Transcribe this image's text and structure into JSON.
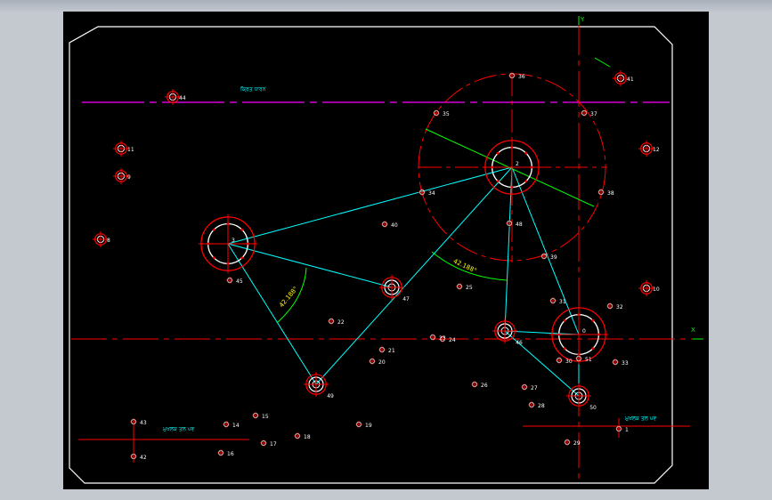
{
  "colors": {
    "background": "#000000",
    "frame": "#ffffff",
    "centerline": "#ff0000",
    "magenta_line": "#ff00ff",
    "construction": "#00ffff",
    "point_label": "#ffffff",
    "note_text": "#00ffff",
    "dimension": "#ffff00",
    "axis": "#00ff00",
    "window_chrome": "#c4c9d0"
  },
  "annotations": {
    "magenta_line_note": "ਕ੍ਰਿਤ ਧਾਰਨ",
    "bottom_left_note": "ਮੁਖਲਕ ਤਲ ਪਵ",
    "bottom_right_note": "ਮੁਖਲਕ ਤਲ ਪਵ",
    "dim_angle_left": "42.188°",
    "dim_angle_right": "42.188°",
    "axis_x": "X",
    "axis_y": "Y"
  },
  "holes": [
    {
      "label": "2",
      "type": "big"
    },
    {
      "label": "3",
      "type": "big"
    },
    {
      "label": "0",
      "type": "big"
    },
    {
      "label": "47",
      "type": "medium"
    },
    {
      "label": "49",
      "type": "medium"
    },
    {
      "label": "46",
      "type": "medium"
    },
    {
      "label": "50",
      "type": "medium"
    },
    {
      "label": "44",
      "type": "small"
    },
    {
      "label": "41",
      "type": "small"
    },
    {
      "label": "11",
      "type": "small"
    },
    {
      "label": "9",
      "type": "small"
    },
    {
      "label": "8",
      "type": "small"
    },
    {
      "label": "12",
      "type": "small"
    },
    {
      "label": "10",
      "type": "small"
    },
    {
      "label": "36",
      "type": "tiny"
    },
    {
      "label": "35",
      "type": "tiny"
    },
    {
      "label": "37",
      "type": "tiny"
    },
    {
      "label": "34",
      "type": "tiny"
    },
    {
      "label": "38",
      "type": "tiny"
    },
    {
      "label": "40",
      "type": "tiny"
    },
    {
      "label": "48",
      "type": "tiny"
    },
    {
      "label": "39",
      "type": "tiny"
    },
    {
      "label": "45",
      "type": "tiny"
    },
    {
      "label": "25",
      "type": "tiny"
    },
    {
      "label": "22",
      "type": "tiny"
    },
    {
      "label": "31",
      "type": "tiny"
    },
    {
      "label": "32",
      "type": "tiny"
    },
    {
      "label": "21",
      "type": "tiny"
    },
    {
      "label": "20",
      "type": "tiny"
    },
    {
      "label": "23",
      "type": "tiny"
    },
    {
      "label": "24",
      "type": "tiny"
    },
    {
      "label": "30",
      "type": "tiny"
    },
    {
      "label": "51",
      "type": "tiny"
    },
    {
      "label": "33",
      "type": "tiny"
    },
    {
      "label": "26",
      "type": "tiny"
    },
    {
      "label": "27",
      "type": "tiny"
    },
    {
      "label": "28",
      "type": "tiny"
    },
    {
      "label": "43",
      "type": "tiny"
    },
    {
      "label": "42",
      "type": "tiny"
    },
    {
      "label": "14",
      "type": "tiny"
    },
    {
      "label": "15",
      "type": "tiny"
    },
    {
      "label": "16",
      "type": "tiny"
    },
    {
      "label": "17",
      "type": "tiny"
    },
    {
      "label": "18",
      "type": "tiny"
    },
    {
      "label": "19",
      "type": "tiny"
    },
    {
      "label": "29",
      "type": "tiny"
    },
    {
      "label": "1",
      "type": "tiny"
    }
  ]
}
